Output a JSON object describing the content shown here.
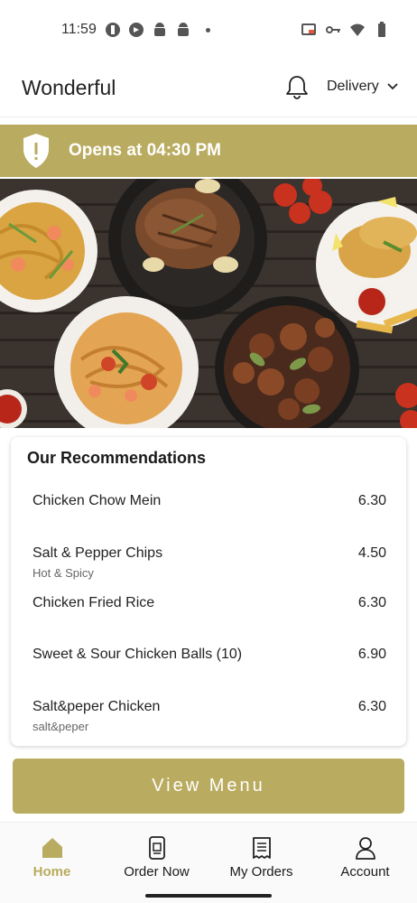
{
  "status_bar": {
    "time": "11:59"
  },
  "header": {
    "title": "Wonderful",
    "delivery_label": "Delivery"
  },
  "banner": {
    "text": "Opens at 04:30 PM",
    "icon_symbol": "!"
  },
  "recommendations": {
    "title": "Our Recommendations",
    "items": [
      {
        "name": "Chicken Chow Mein",
        "sub": "",
        "price": "6.30"
      },
      {
        "name": "Salt & Pepper Chips",
        "sub": "Hot & Spicy",
        "price": "4.50"
      },
      {
        "name": "Chicken Fried Rice",
        "sub": "",
        "price": "6.30"
      },
      {
        "name": "Sweet & Sour Chicken Balls (10)",
        "sub": "",
        "price": "6.90"
      },
      {
        "name": "Salt&peper Chicken",
        "sub": "salt&peper",
        "price": "6.30"
      }
    ]
  },
  "view_menu_label": "View Menu",
  "bottom_nav": {
    "items": [
      {
        "label": "Home",
        "icon": "home-icon",
        "active": true
      },
      {
        "label": "Order Now",
        "icon": "order-now-icon",
        "active": false
      },
      {
        "label": "My Orders",
        "icon": "receipt-icon",
        "active": false
      },
      {
        "label": "Account",
        "icon": "account-icon",
        "active": false
      }
    ]
  },
  "colors": {
    "accent": "#b9ab5f",
    "text": "#1a1a1a",
    "subtext": "#666666"
  }
}
